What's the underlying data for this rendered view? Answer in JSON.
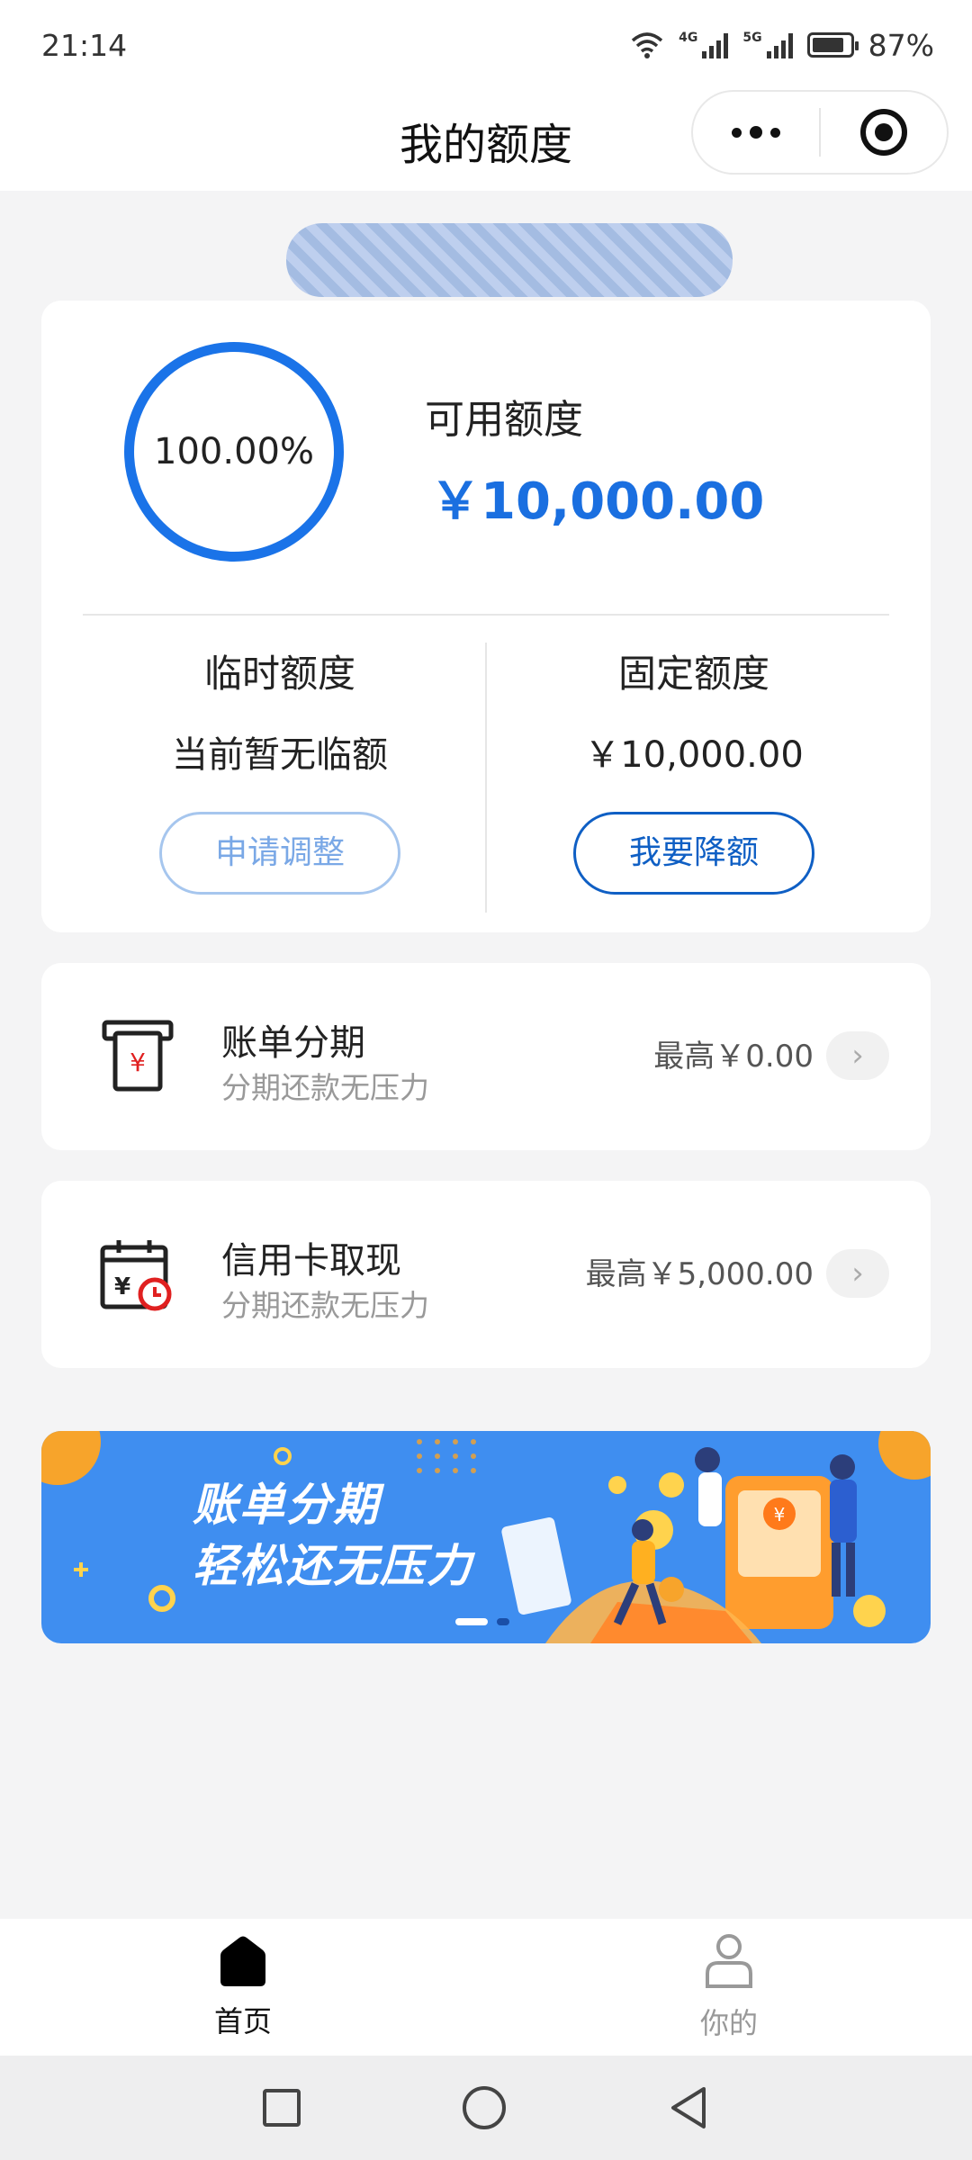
{
  "status_bar": {
    "time": "21:14",
    "network_1": "4G",
    "network_2": "5G",
    "battery": "87%",
    "battery_level": 0.87
  },
  "header": {
    "title": "我的额度"
  },
  "limit": {
    "percent": "100.00%",
    "available_label": "可用额度",
    "available_value": "￥10,000.00",
    "temp_title": "临时额度",
    "temp_value": "当前暂无临额",
    "temp_button": "申请调整",
    "fixed_title": "固定额度",
    "fixed_value": "￥10,000.00",
    "fixed_button": "我要降额"
  },
  "services": [
    {
      "title": "账单分期",
      "subtitle": "分期还款无压力",
      "amount": "最高￥0.00",
      "icon": "bill-installment-icon"
    },
    {
      "title": "信用卡取现",
      "subtitle": "分期还款无压力",
      "amount": "最高￥5,000.00",
      "icon": "cash-withdraw-icon"
    }
  ],
  "banner": {
    "line1": "账单分期",
    "line2": "轻松还无压力"
  },
  "tabbar": {
    "home": "首页",
    "mine": "你的"
  },
  "colors": {
    "accent": "#1a73e8",
    "accent_dark": "#0f5fc4",
    "banner": "#3f8ef0",
    "icon_red": "#e02020"
  }
}
